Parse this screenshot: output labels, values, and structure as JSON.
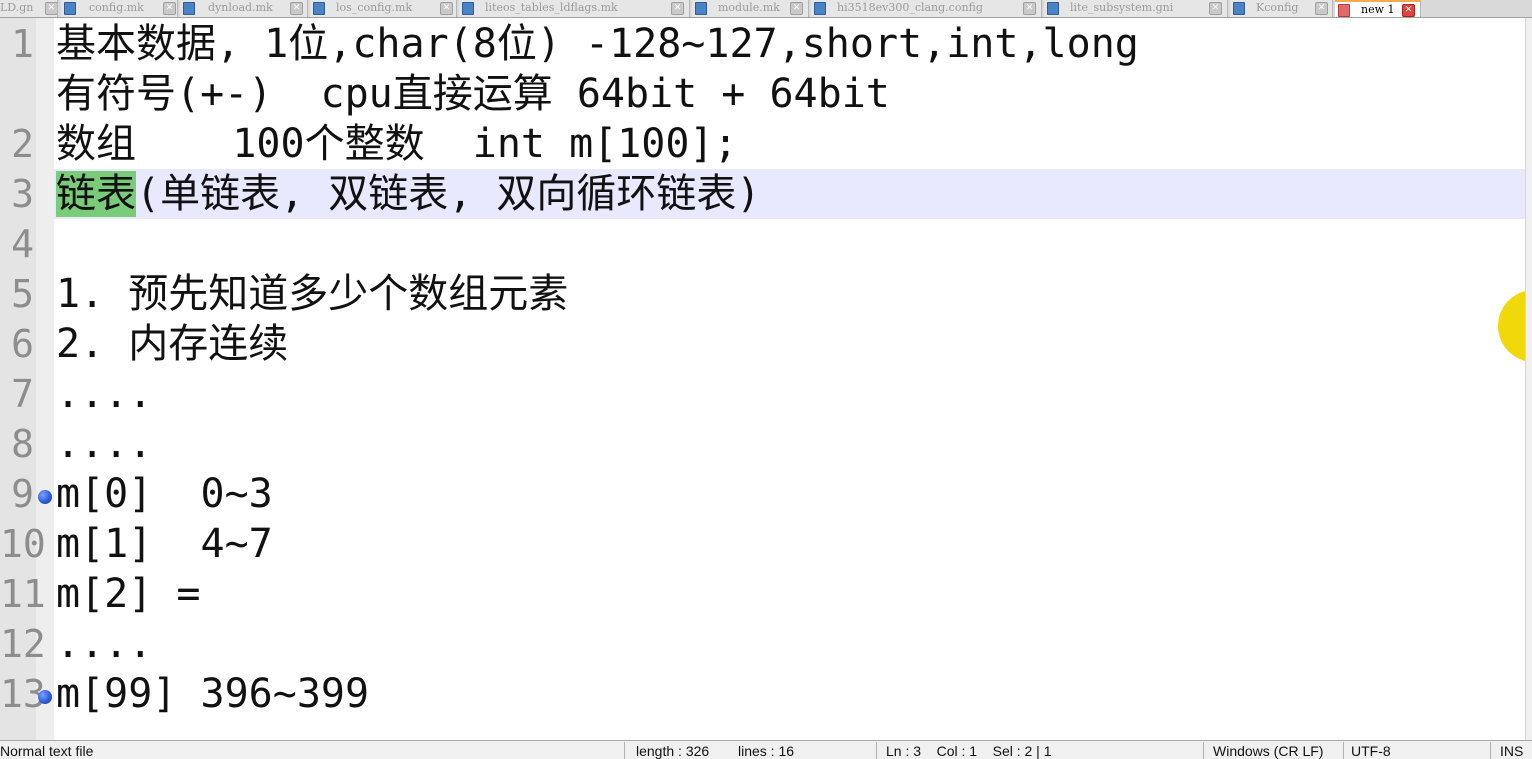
{
  "tabs": [
    {
      "label": "LD.gn",
      "active": false
    },
    {
      "label": "config.mk",
      "active": false
    },
    {
      "label": "dynload.mk",
      "active": false
    },
    {
      "label": "los_config.mk",
      "active": false
    },
    {
      "label": "liteos_tables_ldflags.mk",
      "active": false
    },
    {
      "label": "module.mk",
      "active": false
    },
    {
      "label": "hi3518ev300_clang.config",
      "active": false
    },
    {
      "label": "lite_subsystem.gni",
      "active": false
    },
    {
      "label": "Kconfig",
      "active": false
    },
    {
      "label": "new 1",
      "active": true
    }
  ],
  "editor": {
    "line_numbers": [
      "1",
      "2",
      "3",
      "4",
      "5",
      "6",
      "7",
      "8",
      "9",
      "10",
      "11",
      "12",
      "13"
    ],
    "lines": [
      {
        "text": "基本数据, 1位,char(8位) -128~127,short,int,long"
      },
      {
        "text": "有符号(+-)  cpu直接运算 64bit + 64bit"
      },
      {
        "text": "数组    100个整数  int m[100];"
      },
      {
        "selected": "链表",
        "text": "(单链表, 双链表, 双向循环链表)"
      },
      {
        "text": ""
      },
      {
        "text": "1. 预先知道多少个数组元素"
      },
      {
        "text": "2. 内存连续"
      },
      {
        "text": "...."
      },
      {
        "text": "...."
      },
      {
        "text": "m[0]  0~3"
      },
      {
        "text": "m[1]  4~7"
      },
      {
        "text": "m[2] ="
      },
      {
        "text": "...."
      },
      {
        "text": "m[99] 396~399"
      }
    ],
    "current_line": 3,
    "bookmarked_lines": [
      9,
      13
    ],
    "colors": {
      "selection": "#7acb7a",
      "current_line_bg": "#e8e8ff",
      "bookmark": "#2a55d6",
      "cursor_highlight": "#f1d80a"
    }
  },
  "statusbar": {
    "file_type": "Normal text file",
    "length": "length : 326",
    "lines": "lines : 16",
    "position": "Ln : 3    Col : 1    Sel : 2 | 1",
    "eol": "Windows (CR LF)",
    "encoding": "UTF-8",
    "mode": "INS"
  }
}
